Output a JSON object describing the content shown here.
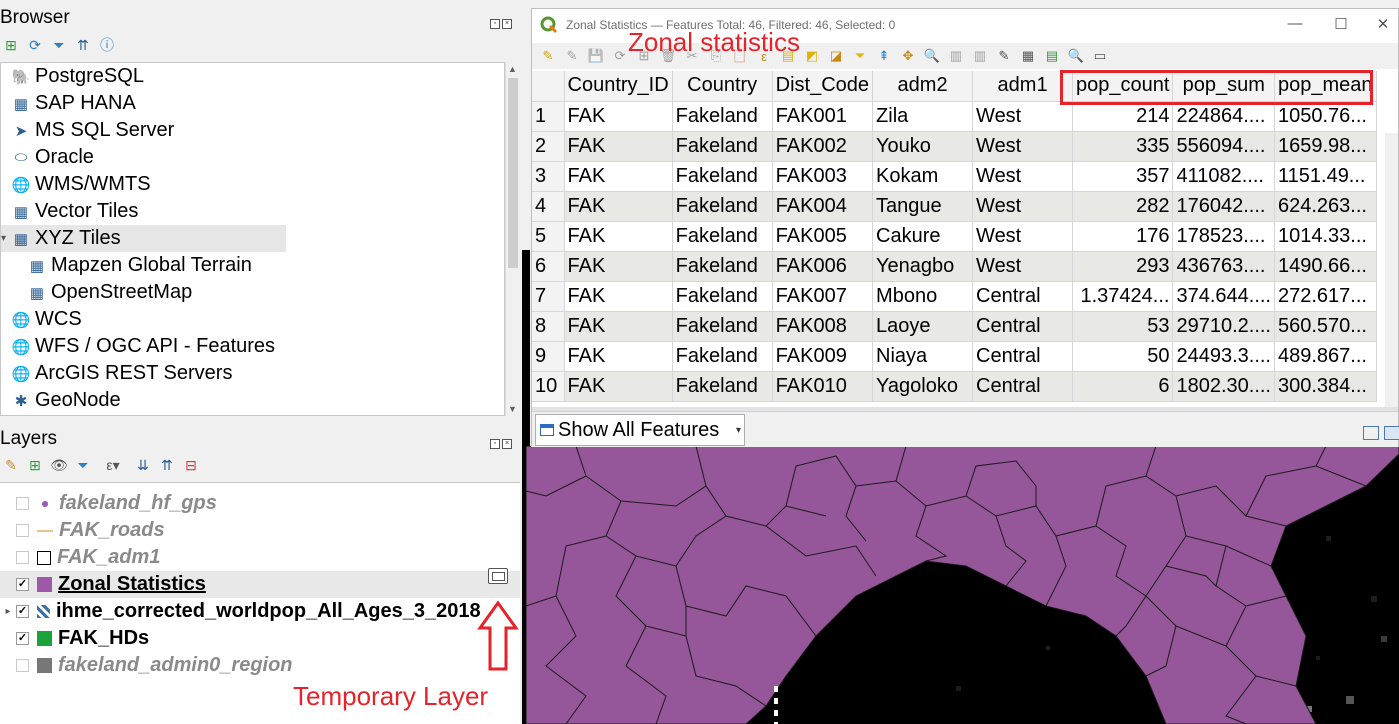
{
  "browser": {
    "title": "Browser",
    "items": [
      {
        "label": "PostgreSQL",
        "icon": "postgresql-icon",
        "glyph": "🐘",
        "indent": 10
      },
      {
        "label": "SAP HANA",
        "icon": "sap-hana-icon",
        "glyph": "▦",
        "indent": 10
      },
      {
        "label": "MS SQL Server",
        "icon": "mssql-icon",
        "glyph": "➤",
        "indent": 10
      },
      {
        "label": "Oracle",
        "icon": "oracle-icon",
        "glyph": "⬭",
        "indent": 10
      },
      {
        "label": "WMS/WMTS",
        "icon": "wms-globe-icon",
        "glyph": "🌐",
        "indent": 10
      },
      {
        "label": "Vector Tiles",
        "icon": "vector-tiles-icon",
        "glyph": "▦",
        "indent": 10
      },
      {
        "label": "XYZ Tiles",
        "icon": "xyz-tiles-icon",
        "glyph": "▦",
        "indent": 10,
        "selected": true,
        "expanded": true
      },
      {
        "label": "Mapzen Global Terrain",
        "icon": "tile-grid-icon",
        "glyph": "▦",
        "indent": 26
      },
      {
        "label": "OpenStreetMap",
        "icon": "tile-grid-icon",
        "glyph": "▦",
        "indent": 26
      },
      {
        "label": "WCS",
        "icon": "wcs-globe-icon",
        "glyph": "🌐",
        "indent": 10
      },
      {
        "label": "WFS / OGC API - Features",
        "icon": "wfs-globe-icon",
        "glyph": "🌐",
        "indent": 10
      },
      {
        "label": "ArcGIS REST Servers",
        "icon": "arcgis-globe-icon",
        "glyph": "🌐",
        "indent": 10
      },
      {
        "label": "GeoNode",
        "icon": "geonode-icon",
        "glyph": "✱",
        "indent": 10
      }
    ]
  },
  "layers": {
    "title": "Layers",
    "items": [
      {
        "name": "fakeland_hf_gps",
        "checked": false,
        "visible": false,
        "symbol": "point",
        "color": "#9b59b6"
      },
      {
        "name": "FAK_roads",
        "checked": false,
        "visible": false,
        "symbol": "line",
        "color": "#e8c38a"
      },
      {
        "name": "FAK_adm1",
        "checked": false,
        "visible": false,
        "symbol": "polygon-outline",
        "color": "#000000"
      },
      {
        "name": "Zonal Statistics",
        "checked": true,
        "visible": true,
        "symbol": "polygon",
        "color": "#9b59a6",
        "selected": true,
        "underline": true,
        "temporary": true
      },
      {
        "name": "ihme_corrected_worldpop_All_Ages_3_2018",
        "checked": true,
        "visible": true,
        "symbol": "raster",
        "color": "#3a6ea5",
        "expandable": true
      },
      {
        "name": "FAK_HDs",
        "checked": true,
        "visible": true,
        "symbol": "polygon",
        "color": "#1aa33a"
      },
      {
        "name": "fakeland_admin0_region",
        "checked": false,
        "visible": false,
        "symbol": "polygon",
        "color": "#777777"
      }
    ]
  },
  "annotations": {
    "temporary_layer": "Temporary Layer",
    "zonal_statistics": "Zonal statistics",
    "color": "#e6232a"
  },
  "attribute_table": {
    "window_title": "Zonal Statistics — Features Total: 46, Filtered: 46, Selected: 0",
    "columns": [
      "Country_ID",
      "Country",
      "Dist_Code",
      "adm2",
      "adm1",
      "pop_count",
      "pop_sum",
      "pop_mean"
    ],
    "rows": [
      {
        "n": "1",
        "cells": [
          "FAK",
          "Fakeland",
          "FAK001",
          "Zila",
          "West",
          "214",
          "224864....",
          "1050.76..."
        ]
      },
      {
        "n": "2",
        "cells": [
          "FAK",
          "Fakeland",
          "FAK002",
          "Youko",
          "West",
          "335",
          "556094....",
          "1659.98..."
        ]
      },
      {
        "n": "3",
        "cells": [
          "FAK",
          "Fakeland",
          "FAK003",
          "Kokam",
          "West",
          "357",
          "411082....",
          "1151.49..."
        ]
      },
      {
        "n": "4",
        "cells": [
          "FAK",
          "Fakeland",
          "FAK004",
          "Tangue",
          "West",
          "282",
          "176042....",
          "624.263..."
        ]
      },
      {
        "n": "5",
        "cells": [
          "FAK",
          "Fakeland",
          "FAK005",
          "Cakure",
          "West",
          "176",
          "178523....",
          "1014.33..."
        ]
      },
      {
        "n": "6",
        "cells": [
          "FAK",
          "Fakeland",
          "FAK006",
          "Yenagbo",
          "West",
          "293",
          "436763....",
          "1490.66..."
        ]
      },
      {
        "n": "7",
        "cells": [
          "FAK",
          "Fakeland",
          "FAK007",
          "Mbono",
          "Central",
          "1.37424...",
          "374.644....",
          "272.617..."
        ]
      },
      {
        "n": "8",
        "cells": [
          "FAK",
          "Fakeland",
          "FAK008",
          "Laoye",
          "Central",
          "53",
          "29710.2....",
          "560.570..."
        ]
      },
      {
        "n": "9",
        "cells": [
          "FAK",
          "Fakeland",
          "FAK009",
          "Niaya",
          "Central",
          "50",
          "24493.3....",
          "489.867..."
        ]
      },
      {
        "n": "10",
        "cells": [
          "FAK",
          "Fakeland",
          "FAK010",
          "Yagoloko",
          "Central",
          "6",
          "1802.30....",
          "300.384..."
        ]
      }
    ],
    "show_all_label": "Show All Features"
  },
  "map": {
    "fill_color": "#96579a",
    "background": "#000000"
  }
}
